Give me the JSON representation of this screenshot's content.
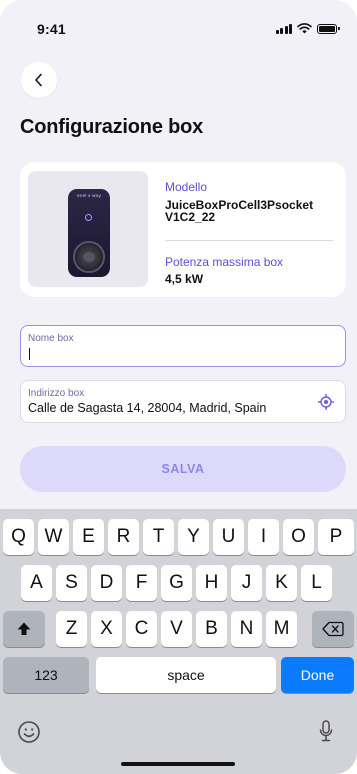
{
  "status_bar": {
    "time": "9:41"
  },
  "header": {
    "title": "Configurazione box"
  },
  "box_card": {
    "brand": "enel x way",
    "model_label": "Modello",
    "model_value_line1": "JuiceBoxProCell3Psocket",
    "model_value_line2": "V1C2_22",
    "power_label": "Potenza massima box",
    "power_value": "4,5 kW"
  },
  "form": {
    "name_field": {
      "label": "Nome box",
      "value": ""
    },
    "address_field": {
      "label": "Indirizzo box",
      "value": "Calle de Sagasta 14, 28004, Madrid, Spain"
    },
    "save_label": "SALVA"
  },
  "keyboard": {
    "row1": [
      "Q",
      "W",
      "E",
      "R",
      "T",
      "Y",
      "U",
      "I",
      "O",
      "P"
    ],
    "row2": [
      "A",
      "S",
      "D",
      "F",
      "G",
      "H",
      "J",
      "K",
      "L"
    ],
    "row3": [
      "Z",
      "X",
      "C",
      "V",
      "B",
      "N",
      "M"
    ],
    "numbers_label": "123",
    "space_label": "space",
    "done_label": "Done"
  },
  "colors": {
    "accent": "#5b4fd6",
    "save_button_bg": "#dcd9fb",
    "done_key": "#0a7aff"
  }
}
